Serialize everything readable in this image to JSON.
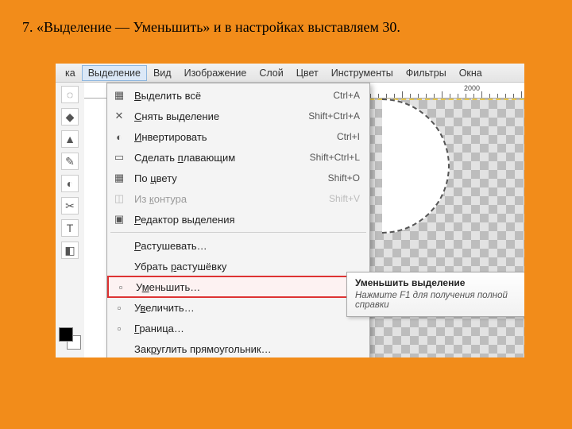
{
  "caption": "7. «Выделение — Уменьшить» и в настройках выставляем 30.",
  "menubar": {
    "items": [
      "ка",
      "Выделение",
      "Вид",
      "Изображение",
      "Слой",
      "Цвет",
      "Инструменты",
      "Фильтры",
      "Окна"
    ]
  },
  "ruler": {
    "mark": "2000"
  },
  "dropdown": {
    "items": [
      {
        "icon": "▦",
        "label": "Выделить всё",
        "u": 0,
        "shortcut": "Ctrl+A",
        "enabled": true
      },
      {
        "icon": "✕",
        "label": "Снять выделение",
        "u": 0,
        "shortcut": "Shift+Ctrl+A",
        "enabled": true
      },
      {
        "icon": "◐",
        "label": "Инвертировать",
        "u": 0,
        "shortcut": "Ctrl+I",
        "enabled": true
      },
      {
        "icon": "▭",
        "label": "Сделать плавающим",
        "u": 8,
        "shortcut": "Shift+Ctrl+L",
        "enabled": true
      },
      {
        "icon": "▦",
        "label": "По цвету",
        "u": 3,
        "shortcut": "Shift+O",
        "enabled": true
      },
      {
        "icon": "◫",
        "label": "Из контура",
        "u": 3,
        "shortcut": "Shift+V",
        "enabled": false
      },
      {
        "icon": "▣",
        "label": "Редактор выделения",
        "u": 0,
        "shortcut": "",
        "enabled": true
      },
      "sep",
      {
        "icon": "",
        "label": "Растушевать…",
        "u": 0,
        "shortcut": "",
        "enabled": true
      },
      {
        "icon": "",
        "label": "Убрать растушёвку",
        "u": 7,
        "shortcut": "",
        "enabled": true
      },
      {
        "icon": "▫",
        "label": "Уменьшить…",
        "u": 1,
        "shortcut": "",
        "enabled": true,
        "highlighted": true
      },
      {
        "icon": "▫",
        "label": "Увеличить…",
        "u": 1,
        "shortcut": "",
        "enabled": true
      },
      {
        "icon": "▫",
        "label": "Граница…",
        "u": 0,
        "shortcut": "",
        "enabled": true
      },
      {
        "icon": "",
        "label": "Закруглить прямоугольник…",
        "u": 3,
        "shortcut": "",
        "enabled": true
      }
    ]
  },
  "tooltip": {
    "title": "Уменьшить выделение",
    "sub": "Нажмите F1 для получения полной справки"
  },
  "tool_icons": [
    "◌",
    "◆",
    "▲",
    "✎",
    "◐",
    "✂",
    "T",
    "◧"
  ]
}
